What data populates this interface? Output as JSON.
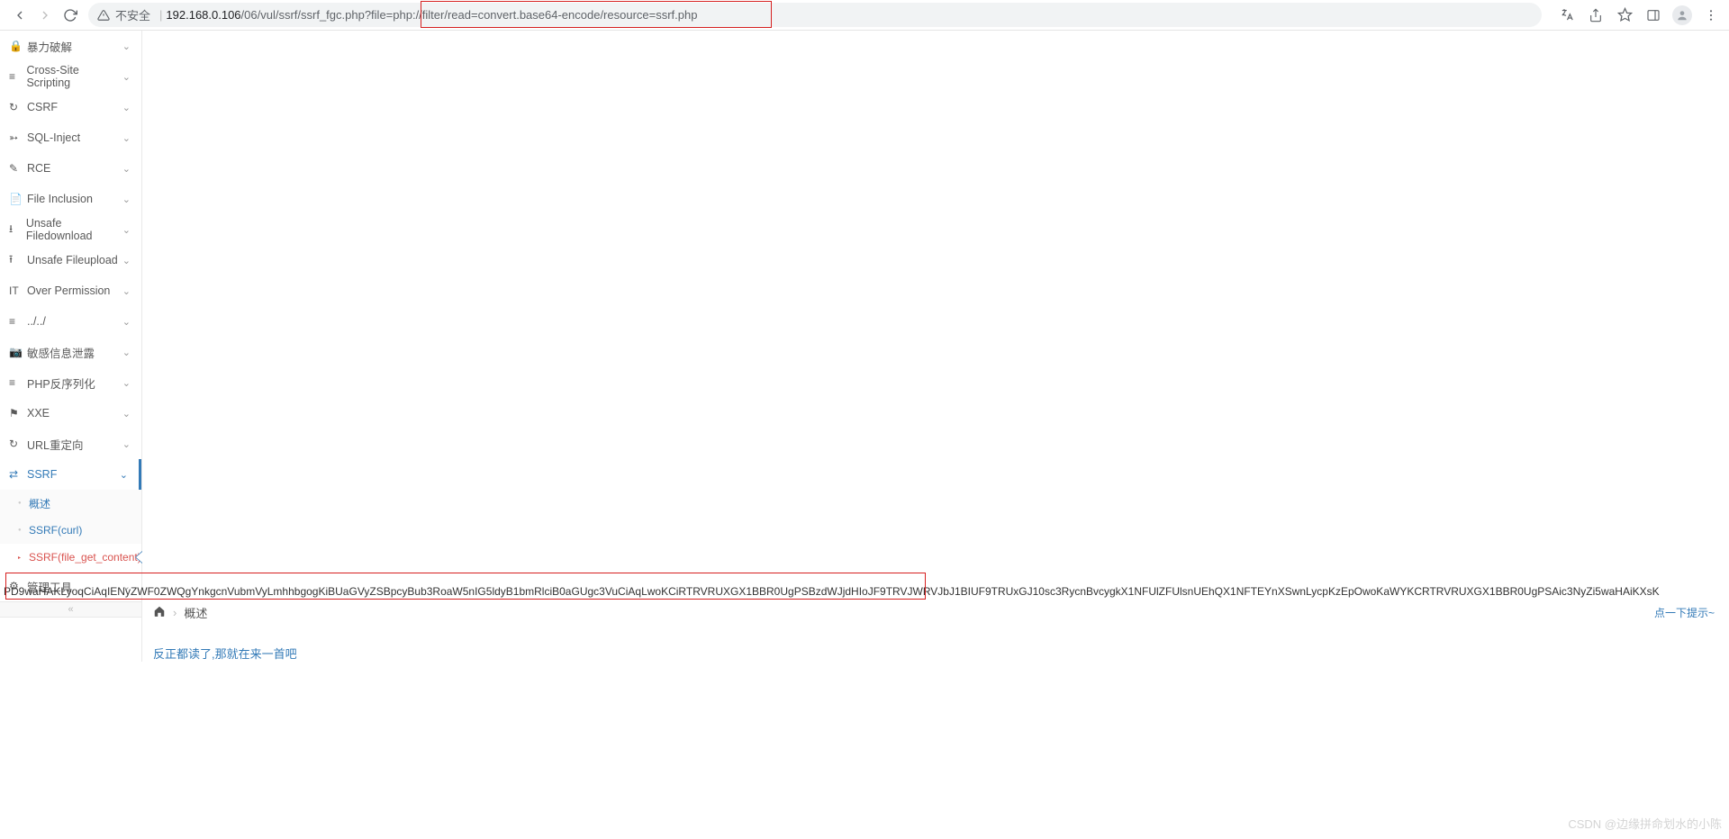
{
  "browser": {
    "insecure_label": "不安全",
    "url_host": "192.168.0.106",
    "url_path": "/06/vul/ssrf/ssrf_fgc.php",
    "url_query": "?file=php://filter/read=convert.base64-encode/resource=ssrf.php"
  },
  "sidebar": {
    "items": [
      {
        "icon": "lock-icon",
        "glyph": "🔒",
        "label": "暴力破解"
      },
      {
        "icon": "xss-icon",
        "glyph": "≡",
        "label": "Cross-Site Scripting"
      },
      {
        "icon": "refresh-icon",
        "glyph": "↻",
        "label": "CSRF"
      },
      {
        "icon": "sql-icon",
        "glyph": "➳",
        "label": "SQL-Inject"
      },
      {
        "icon": "pencil-icon",
        "glyph": "✎",
        "label": "RCE"
      },
      {
        "icon": "file-icon",
        "glyph": "📄",
        "label": "File Inclusion"
      },
      {
        "icon": "download-icon",
        "glyph": "⭳",
        "label": "Unsafe Filedownload"
      },
      {
        "icon": "upload-icon",
        "glyph": "⭱",
        "label": "Unsafe Fileupload"
      },
      {
        "icon": "it-icon",
        "glyph": "IT",
        "label": "Over Permission"
      },
      {
        "icon": "path-icon",
        "glyph": "≡",
        "label": "../../"
      },
      {
        "icon": "camera-icon",
        "glyph": "📷",
        "label": "敏感信息泄露"
      },
      {
        "icon": "php-icon",
        "glyph": "≡",
        "label": "PHP反序列化"
      },
      {
        "icon": "flag-icon",
        "glyph": "⚑",
        "label": "XXE"
      },
      {
        "icon": "redirect-icon",
        "glyph": "↻",
        "label": "URL重定向"
      },
      {
        "icon": "ssrf-icon",
        "glyph": "⇄",
        "label": "SSRF"
      },
      {
        "icon": "gear-icon",
        "glyph": "⚙",
        "label": "管理工具"
      }
    ],
    "ssrf_sub": [
      {
        "label": "概述"
      },
      {
        "label": "SSRF(curl)"
      },
      {
        "label": "SSRF(file_get_content)"
      }
    ]
  },
  "content": {
    "base64_output": "PD9waHAKLyoqCiAqIENyZWF0ZWQgYnkgcnVubmVyLmhhbgogKiBUaGVyZSBpcyBub3RoaW5nIG5ldyB1bmRlciB0aGUgc3VuCiAqLwoKCiRTRVRUXGX1BBR0UgPSBzdWJjdHIoJF9TRVJWRVJbJ1BIUF9TRUxGJ10sc3RycnBvcygkX1NFUlZFUlsnUEhQX1NFTEYnXSwnLycpKzEpOwoKaWYKCRTRVRUXGX1BBR0UgPSAic3NyZi5waHAiKXsK",
    "breadcrumb_current": "概述",
    "tip_label": "点一下提示~",
    "desc_link": "反正都读了,那就在来一首吧"
  },
  "watermark": "CSDN @边缘拼命划水的小陈"
}
